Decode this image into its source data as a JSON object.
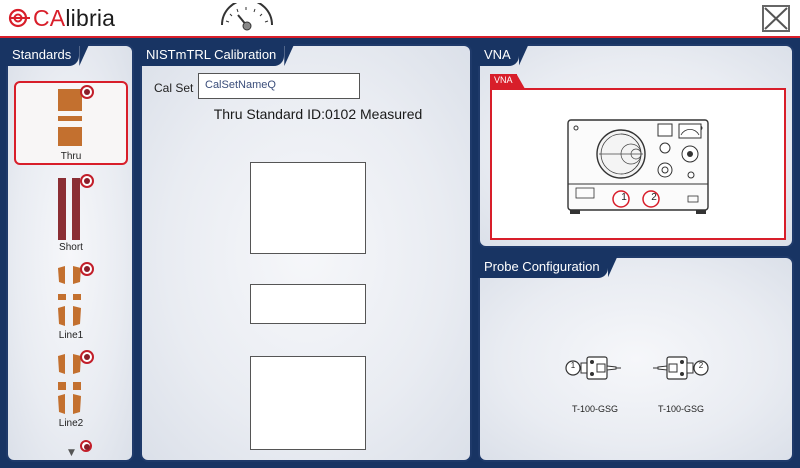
{
  "app": {
    "logo_text_red": "CA",
    "logo_text": "libria"
  },
  "panels": {
    "standards": "Standards",
    "calibration": "NISTmTRL Calibration",
    "vna": "VNA",
    "probe": "Probe Configuration"
  },
  "standards": [
    {
      "label": "Thru",
      "selected": true
    },
    {
      "label": "Short",
      "selected": false
    },
    {
      "label": "Line1",
      "selected": false
    },
    {
      "label": "Line2",
      "selected": false
    }
  ],
  "calibration": {
    "calset_label": "Cal Set",
    "calset_value": "CalSetNameQ",
    "status_text": "Thru Standard ID:0102 Measured"
  },
  "vna": {
    "tag": "VNA",
    "port1": "1",
    "port2": "2"
  },
  "probes": [
    {
      "label": "T-100-GSG",
      "port": "1"
    },
    {
      "label": "T-100-GSG",
      "port": "2"
    }
  ],
  "colors": {
    "accent": "#d81e2a",
    "workspace": "#183463",
    "standard_copper": "#c3702f",
    "standard_short": "#8b2e34"
  }
}
